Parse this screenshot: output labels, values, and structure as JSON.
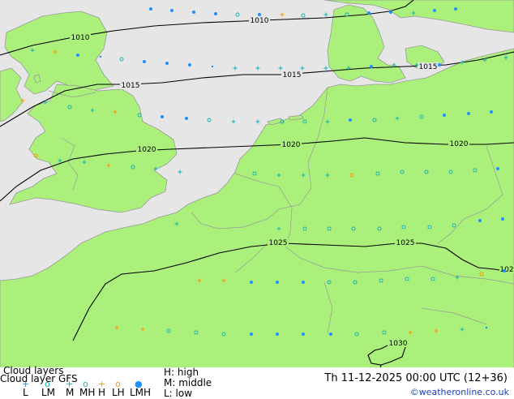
{
  "map": {
    "colors": {
      "sea": "#e6e6e6",
      "land": "#aaf07a",
      "border": "#9a9a9a",
      "isobar": "#000000",
      "cloud_low": "#1e90ff",
      "cloud_high": "#1e90ff",
      "cloud_middle": "#17b3b3",
      "cloud_lowmid": "#ff9900"
    },
    "isobars": [
      {
        "label": "1010"
      },
      {
        "label": "1010"
      },
      {
        "label": "1015"
      },
      {
        "label": "1015"
      },
      {
        "label": "1015"
      },
      {
        "label": "1020"
      },
      {
        "label": "1020"
      },
      {
        "label": "1020"
      },
      {
        "label": "1025"
      },
      {
        "label": "1025"
      },
      {
        "label": "102"
      },
      {
        "label": "1030"
      }
    ]
  },
  "footer": {
    "title": "Cloud layers",
    "subtitle": "Cloud layer GFS",
    "legend_symbols": [
      "+",
      "o",
      "+",
      "o",
      "+",
      "o",
      "●"
    ],
    "legend_codes": [
      "L",
      "LM",
      "M",
      "MH",
      "H",
      "LH",
      "LMH"
    ],
    "key_high": "H: high",
    "key_middle": "M: middle",
    "key_low": "L: low",
    "datetime": "Th 11-12-2025 00:00 UTC (12+36)",
    "credit": "©weatheronline.co.uk"
  }
}
